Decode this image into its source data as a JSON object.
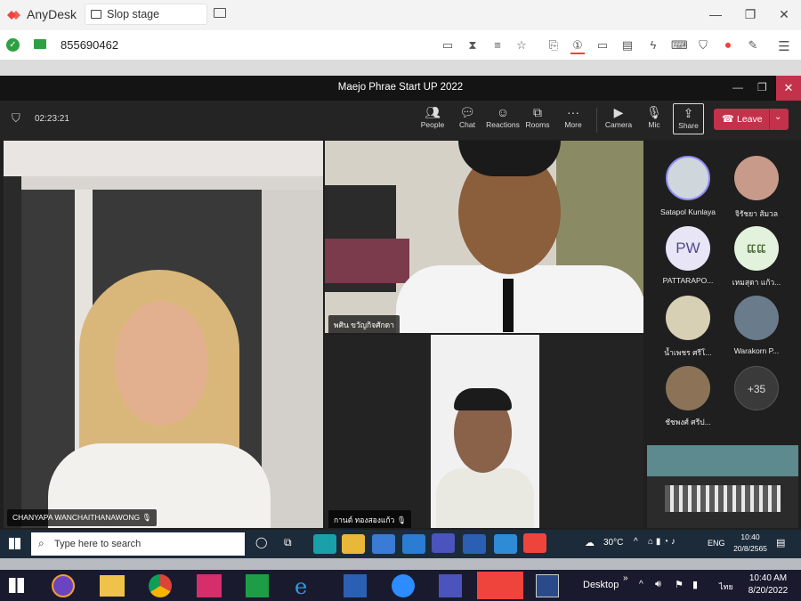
{
  "anydesk": {
    "brand": "AnyDesk",
    "tab_label": "Slop stage",
    "address_id": "855690462"
  },
  "teams": {
    "window_title": "Maejo Phrae Start UP 2022",
    "timer": "02:23:21",
    "toolbar": [
      {
        "label": "People",
        "icon": "people-icon"
      },
      {
        "label": "Chat",
        "icon": "chat-icon"
      },
      {
        "label": "Reactions",
        "icon": "reactions-icon"
      },
      {
        "label": "Rooms",
        "icon": "rooms-icon"
      },
      {
        "label": "More",
        "icon": "more-icon"
      },
      {
        "label": "Camera",
        "icon": "camera-icon"
      },
      {
        "label": "Mic",
        "icon": "mic-off-icon"
      },
      {
        "label": "Share",
        "icon": "share-icon"
      }
    ],
    "leave_label": "Leave",
    "videos": [
      {
        "name": "CHANYAPA WANCHAITHANAWONG"
      },
      {
        "name": "พศิน ขวัญกิจศักดา"
      },
      {
        "name": "กานต์ ทองสองแก้ว"
      }
    ],
    "participants": [
      {
        "name": "Satapol Kunlaya",
        "initials": ""
      },
      {
        "name": "จิรัชยา ส้มวล",
        "initials": ""
      },
      {
        "name": "PATTARAPO...",
        "initials": "PW"
      },
      {
        "name": "เหมสุดา แก้ว...",
        "initials": "ແແ"
      },
      {
        "name": "น้ำเพชร ศรีโ...",
        "initials": ""
      },
      {
        "name": "Warakorn P...",
        "initials": ""
      },
      {
        "name": "ชัชพงศ์ ศรีป...",
        "initials": ""
      }
    ],
    "more_count": "+35"
  },
  "remote_taskbar": {
    "search_placeholder": "Type here to search",
    "temperature": "30°C",
    "language": "ENG",
    "time": "10:40",
    "date": "20/8/2565"
  },
  "local_taskbar": {
    "desktop_label": "Desktop",
    "lang": "ไทย",
    "time": "10:40 AM",
    "date": "8/20/2022"
  },
  "colors": {
    "anydesk_red": "#ef443b",
    "leave_red": "#c4314b",
    "teams_bg": "#1f1f1f"
  }
}
